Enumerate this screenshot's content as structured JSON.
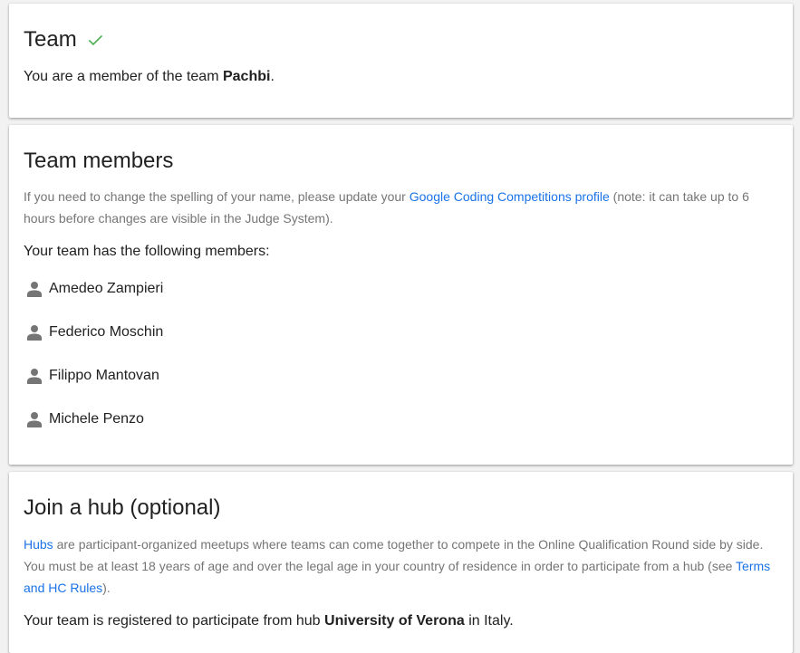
{
  "team_card": {
    "title": "Team",
    "status_icon": "checkmark-icon",
    "check_color": "#4caf50",
    "membership_prefix": "You are a member of the team ",
    "team_name": "Pachbi",
    "membership_suffix": "."
  },
  "members_card": {
    "title": "Team members",
    "note_prefix": "If you need to change the spelling of your name, please update your ",
    "note_link": "Google Coding Competitions profile",
    "note_suffix": " (note: it can take up to 6 hours before changes are visible in the Judge System).",
    "list_intro": "Your team has the following members:",
    "member_icon": "person-icon",
    "members": [
      {
        "name": "Amedeo Zampieri"
      },
      {
        "name": "Federico Moschin"
      },
      {
        "name": "Filippo Mantovan"
      },
      {
        "name": "Michele Penzo"
      }
    ]
  },
  "hub_card": {
    "title": "Join a hub (optional)",
    "desc_link": "Hubs",
    "desc_text": " are participant-organized meetups where teams can come together to compete in the Online Qualification Round side by side. You must be at least 18 years of age and over the legal age in your country of residence in order to participate from a hub (see ",
    "rules_link": "Terms and HC Rules",
    "desc_end": ").",
    "registered_prefix": "Your team is registered to participate from hub ",
    "hub_name": "University of Verona",
    "registered_suffix": " in Italy."
  },
  "colors": {
    "link": "#1a73e8",
    "muted_text": "#757575",
    "icon_grey": "#757575"
  }
}
